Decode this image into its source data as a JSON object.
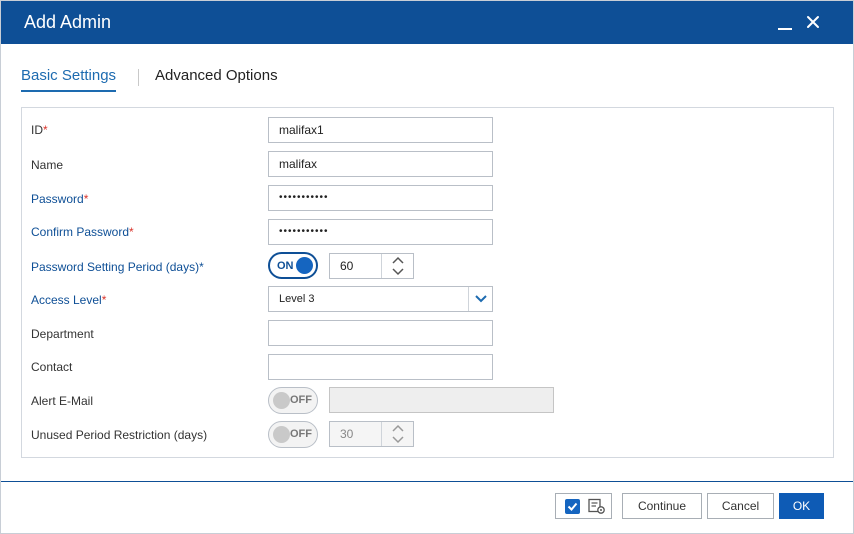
{
  "window": {
    "title": "Add Admin"
  },
  "tabs": [
    {
      "label": "Basic Settings",
      "active": true
    },
    {
      "label": "Advanced Options",
      "active": false
    }
  ],
  "form": {
    "id": {
      "label": "ID",
      "required_mark": "*",
      "value": "malifax1"
    },
    "name": {
      "label": "Name",
      "value": "malifax"
    },
    "password": {
      "label": "Password",
      "required_mark": "*",
      "value": "•••••••••••"
    },
    "confirm_password": {
      "label": "Confirm Password",
      "required_mark": "*",
      "value": "•••••••••••"
    },
    "password_period": {
      "label": "Password Setting Period (days)*",
      "toggle": "ON",
      "value": "60"
    },
    "access_level": {
      "label": "Access Level",
      "required_mark": "*",
      "value": "Level 3"
    },
    "department": {
      "label": "Department",
      "value": ""
    },
    "contact": {
      "label": "Contact",
      "value": ""
    },
    "alert_email": {
      "label": "Alert E-Mail",
      "toggle": "OFF",
      "value": ""
    },
    "unused_period": {
      "label": "Unused Period Restriction (days)",
      "toggle": "OFF",
      "value": "30"
    }
  },
  "footer": {
    "continue_label": "Continue",
    "cancel_label": "Cancel",
    "ok_label": "OK"
  },
  "colors": {
    "titlebar": "#0e4f96",
    "accent": "#1565c0",
    "required": "#d9342b"
  }
}
